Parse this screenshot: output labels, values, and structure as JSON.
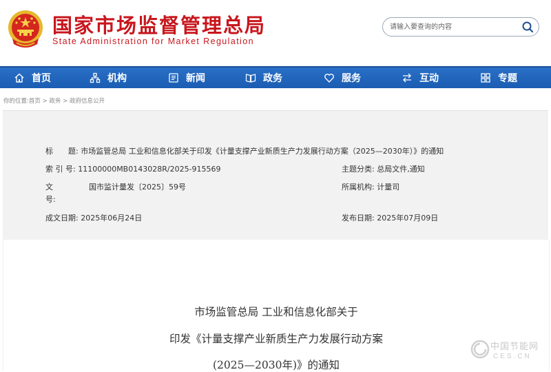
{
  "header": {
    "title_cn": "国家市场监督管理总局",
    "title_en": "State Administration for Market Regulation",
    "brand_color": "#c8161d",
    "search_placeholder": "请输入要查询的内容"
  },
  "nav": {
    "color": "#1f63bb",
    "items": [
      {
        "label": "首页",
        "icon": "home-icon"
      },
      {
        "label": "机构",
        "icon": "org-chart-icon"
      },
      {
        "label": "新闻",
        "icon": "newspaper-icon"
      },
      {
        "label": "政务",
        "icon": "open-book-icon"
      },
      {
        "label": "服务",
        "icon": "heart-icon"
      },
      {
        "label": "互动",
        "icon": "swap-arrows-icon"
      },
      {
        "label": "专题",
        "icon": "grid-icon"
      }
    ]
  },
  "breadcrumb": {
    "prefix": "你的位置:",
    "items": [
      "首页",
      "政务",
      "政府信息公开"
    ],
    "sep": " > "
  },
  "meta": {
    "title_label": "标　　题:",
    "title_value": "市场监管总局 工业和信息化部关于印发《计量支撑产业新质生产力发展行动方案（2025—2030年）》的通知",
    "index_label": "索 引 号:",
    "index_value": "11100000MB0143028R/2025-915569",
    "topic_label": "主题分类:",
    "topic_value": "总局文件,通知",
    "docno_label_1": "文",
    "docno_label_2": "号:",
    "docno_value": "国市监计量发〔2025〕59号",
    "org_label": "所属机构:",
    "org_value": "计量司",
    "date_label": "成文日期:",
    "date_value": "2025年06月24日",
    "pub_label": "发布日期:",
    "pub_value": "2025年07月09日"
  },
  "document": {
    "line1": "市场监管总局 工业和信息化部关于",
    "line2": "印发《计量支撑产业新质生产力发展行动方案",
    "line3": "(2025—2030年)》的通知"
  },
  "watermark": {
    "cn": "中国节能网",
    "en": "CES.CN"
  }
}
